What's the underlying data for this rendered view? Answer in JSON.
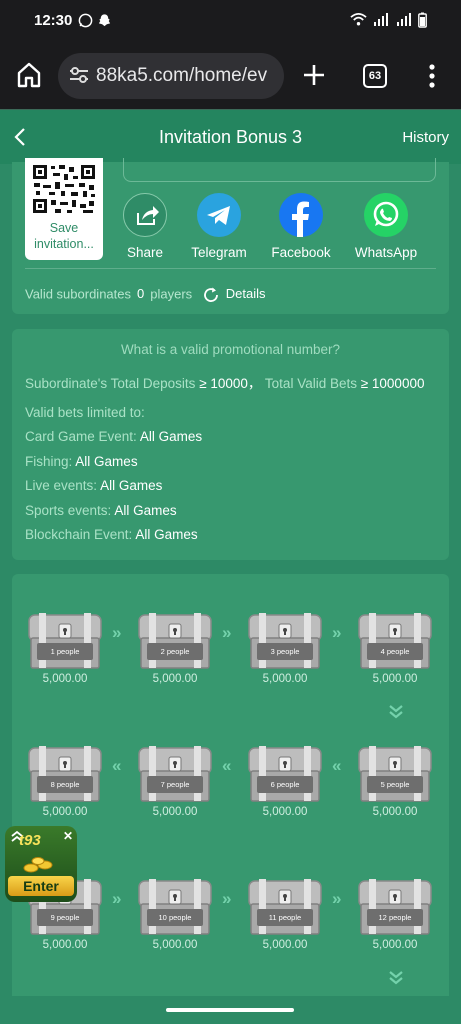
{
  "status_bar": {
    "time": "12:30"
  },
  "browser": {
    "url": "88ka5.com/home/ev",
    "tab_count": "63"
  },
  "header": {
    "title": "Invitation Bonus 3",
    "history_label": "History"
  },
  "invite": {
    "qr_caption": "Save invitation...",
    "share_buttons": [
      {
        "label": "Share",
        "icon": "share-icon",
        "color": "#2f8c67"
      },
      {
        "label": "Telegram",
        "icon": "telegram-icon",
        "color": "#2aa3df"
      },
      {
        "label": "Facebook",
        "icon": "facebook-icon",
        "color": "#1877f2"
      },
      {
        "label": "WhatsApp",
        "icon": "whatsapp-icon",
        "color": "#25d366"
      }
    ],
    "valid_label": "Valid subordinates",
    "valid_count": "0",
    "players_label": "players",
    "details_label": "Details"
  },
  "rules": {
    "heading": "What is a valid promotional number?",
    "deposits_label": "Subordinate's Total Deposits",
    "deposits_value": "≥ 10000",
    "separator": "，",
    "bets_label": "Total Valid Bets",
    "bets_value": "≥ 1000000",
    "limited_label": "Valid bets limited to:",
    "categories": [
      {
        "label": "Card Game Event:",
        "value": "All Games"
      },
      {
        "label": "Fishing:",
        "value": "All Games"
      },
      {
        "label": "Live events:",
        "value": "All Games"
      },
      {
        "label": "Sports events:",
        "value": "All Games"
      },
      {
        "label": "Blockchain Event:",
        "value": "All Games"
      }
    ]
  },
  "chests": [
    {
      "people": "1 people",
      "amount": "5,000.00"
    },
    {
      "people": "2 people",
      "amount": "5,000.00"
    },
    {
      "people": "3 people",
      "amount": "5,000.00"
    },
    {
      "people": "4 people",
      "amount": "5,000.00"
    },
    {
      "people": "8 people",
      "amount": "5,000.00"
    },
    {
      "people": "7 people",
      "amount": "5,000.00"
    },
    {
      "people": "6 people",
      "amount": "5,000.00"
    },
    {
      "people": "5 people",
      "amount": "5,000.00"
    },
    {
      "people": "9 people",
      "amount": "5,000.00"
    },
    {
      "people": "10 people",
      "amount": "5,000.00"
    },
    {
      "people": "11 people",
      "amount": "5,000.00"
    },
    {
      "people": "12 people",
      "amount": "5,000.00"
    }
  ],
  "promo": {
    "brand": "t93",
    "enter_label": "Enter"
  },
  "colors": {
    "background": "#2d8a66",
    "panel": "#37986f",
    "accent": "#74d2ac"
  }
}
